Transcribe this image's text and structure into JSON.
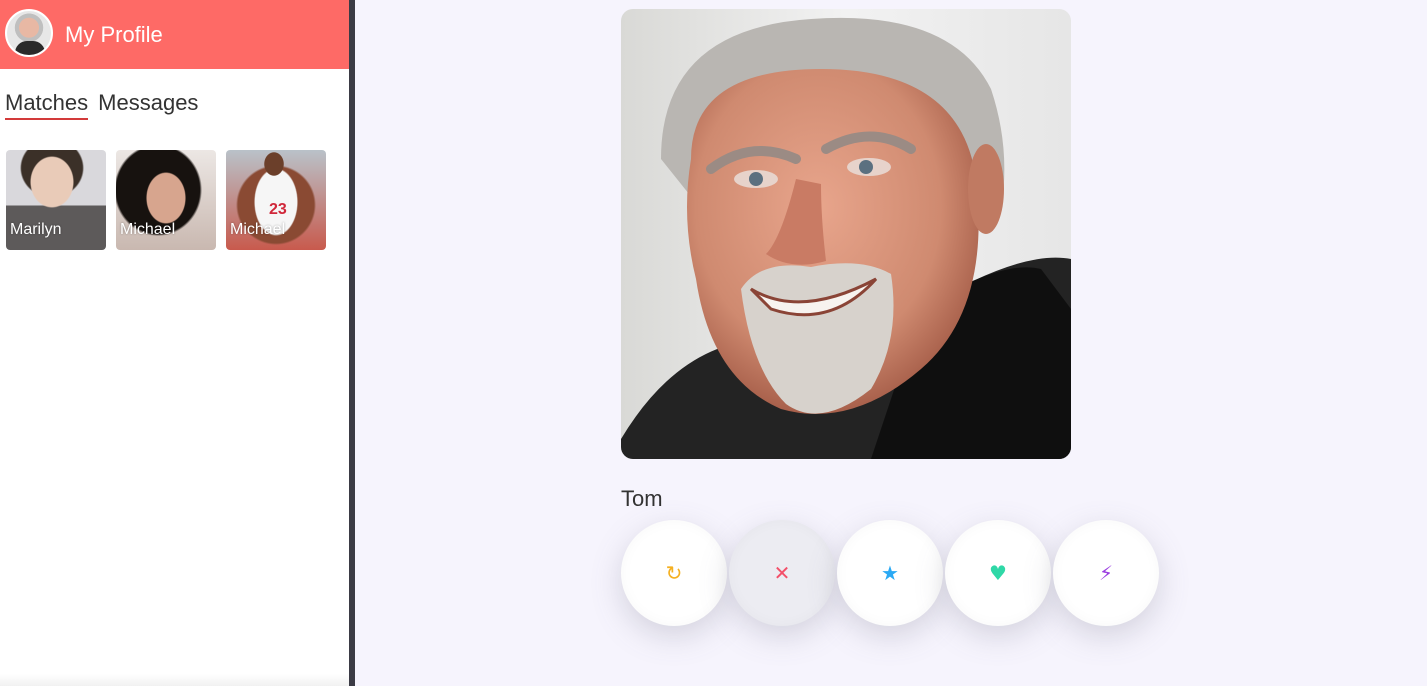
{
  "sidebar": {
    "profile_title": "My Profile",
    "tabs": [
      {
        "label": "Matches",
        "active": true
      },
      {
        "label": "Messages",
        "active": false
      }
    ],
    "matches": [
      {
        "name": "Marilyn"
      },
      {
        "name": "Michael"
      },
      {
        "name": "Michael",
        "jersey": "23"
      }
    ]
  },
  "main": {
    "profile_name": "Tom",
    "actions": [
      {
        "name": "rewind",
        "icon": "↻",
        "color": "#f5b021"
      },
      {
        "name": "nope",
        "icon": "✕",
        "color": "#f3506a"
      },
      {
        "name": "super-like",
        "icon": "★",
        "color": "#2aa9f4"
      },
      {
        "name": "like",
        "icon": "♥",
        "color": "#2fd8a7"
      },
      {
        "name": "boost",
        "icon": "⚡",
        "color": "#9b3fe0"
      }
    ]
  },
  "colors": {
    "header": "#fe6a66",
    "divider": "#3b3b45",
    "tab_underline": "#d33a3a",
    "main_background": "#f6f4fd"
  }
}
